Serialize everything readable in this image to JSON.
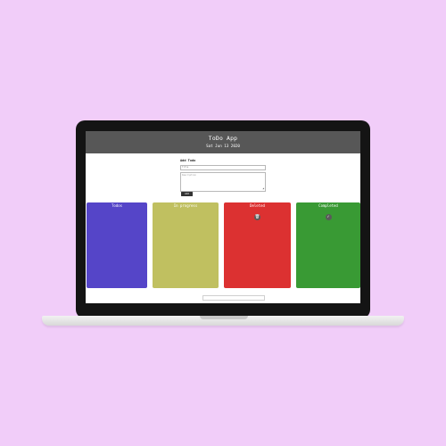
{
  "app": {
    "title": "ToDo App",
    "date": "Sat Jun 13 2020"
  },
  "form": {
    "heading": "Add Todo",
    "title_placeholder": "Title",
    "description_placeholder": "Description",
    "add_label": "Add"
  },
  "columns": [
    {
      "title": "Todos",
      "color": "#5545c8"
    },
    {
      "title": "In progress",
      "color": "#c0c060"
    },
    {
      "title": "Deleted",
      "color": "#dc3131"
    },
    {
      "title": "Completed",
      "color": "#399a34"
    }
  ],
  "icons": {
    "deleted": "trash-icon",
    "completed": "check-icon"
  },
  "footer": {
    "link_1": "",
    "link_2": "",
    "note": "",
    "link_3": ""
  },
  "colors": {
    "background": "#f1cdf9",
    "header": "#575757"
  }
}
